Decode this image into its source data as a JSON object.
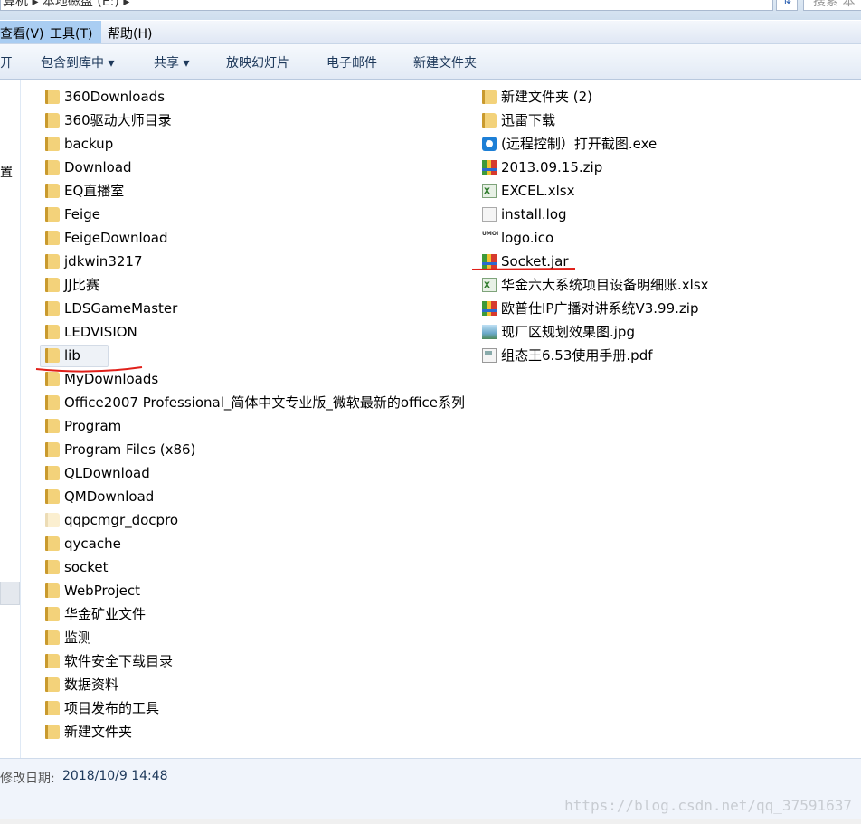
{
  "address_bar": {
    "path": "算机 ▸ 本地磁盘 (E:) ▸",
    "search_placeholder": "搜索 本"
  },
  "menu": [
    "查看(V)",
    "工具(T)",
    "帮助(H)"
  ],
  "toolbar": [
    "开",
    "包含到库中 ▾",
    "共享 ▾",
    "放映幻灯片",
    "电子邮件",
    "新建文件夹"
  ],
  "nav_pane": {
    "partial_label": "置"
  },
  "files_left": [
    {
      "name": "360Downloads",
      "icon": "folder-icon"
    },
    {
      "name": "360驱动大师目录",
      "icon": "folder-icon"
    },
    {
      "name": "backup",
      "icon": "folder-icon"
    },
    {
      "name": "Download",
      "icon": "folder-icon"
    },
    {
      "name": "EQ直播室",
      "icon": "folder-icon"
    },
    {
      "name": "Feige",
      "icon": "folder-icon"
    },
    {
      "name": "FeigeDownload",
      "icon": "folder-icon"
    },
    {
      "name": "jdkwin3217",
      "icon": "folder-icon"
    },
    {
      "name": "JJ比赛",
      "icon": "folder-icon"
    },
    {
      "name": "LDSGameMaster",
      "icon": "folder-icon"
    },
    {
      "name": "LEDVISION",
      "icon": "folder-icon"
    },
    {
      "name": "lib",
      "icon": "folder-icon"
    },
    {
      "name": "MyDownloads",
      "icon": "folder-icon"
    },
    {
      "name": "Office2007 Professional_简体中文专业版_微软最新的office系列",
      "icon": "folder-icon"
    },
    {
      "name": "Program",
      "icon": "folder-icon"
    },
    {
      "name": "Program Files (x86)",
      "icon": "folder-icon"
    },
    {
      "name": "QLDownload",
      "icon": "folder-icon"
    },
    {
      "name": "QMDownload",
      "icon": "folder-icon"
    },
    {
      "name": "qqpcmgr_docpro",
      "icon": "folder-hidden-icon"
    },
    {
      "name": "qycache",
      "icon": "folder-icon"
    },
    {
      "name": "socket",
      "icon": "folder-icon"
    },
    {
      "name": "WebProject",
      "icon": "folder-icon"
    },
    {
      "name": "华金矿业文件",
      "icon": "folder-icon"
    },
    {
      "name": "监测",
      "icon": "folder-icon"
    },
    {
      "name": "软件安全下载目录",
      "icon": "folder-icon"
    },
    {
      "name": "数据资料",
      "icon": "folder-icon"
    },
    {
      "name": "项目发布的工具",
      "icon": "folder-icon"
    },
    {
      "name": "新建文件夹",
      "icon": "folder-icon"
    }
  ],
  "files_right": [
    {
      "name": "新建文件夹 (2)",
      "icon": "folder-icon"
    },
    {
      "name": "迅雷下载",
      "icon": "folder-icon"
    },
    {
      "name": "(远程控制）打开截图.exe",
      "icon": "exe-icon"
    },
    {
      "name": "2013.09.15.zip",
      "icon": "zip-icon"
    },
    {
      "name": "EXCEL.xlsx",
      "icon": "xlsx-icon"
    },
    {
      "name": "install.log",
      "icon": "log-icon"
    },
    {
      "name": "logo.ico",
      "icon": "ico-icon"
    },
    {
      "name": "Socket.jar",
      "icon": "jar-icon"
    },
    {
      "name": "华金六大系统项目设备明细账.xlsx",
      "icon": "xlsx-icon"
    },
    {
      "name": "欧普仕IP广播对讲系统V3.99.zip",
      "icon": "zip-icon"
    },
    {
      "name": "现厂区规划效果图.jpg",
      "icon": "jpg-icon"
    },
    {
      "name": "组态王6.53使用手册.pdf",
      "icon": "pdf-icon"
    }
  ],
  "status": {
    "label": "修改日期:",
    "value": "2018/10/9 14:48"
  },
  "watermark": "https://blog.csdn.net/qq_37591637",
  "colors": {
    "annotation": "#e0201a",
    "menu_highlight": "#a9cdf2"
  }
}
